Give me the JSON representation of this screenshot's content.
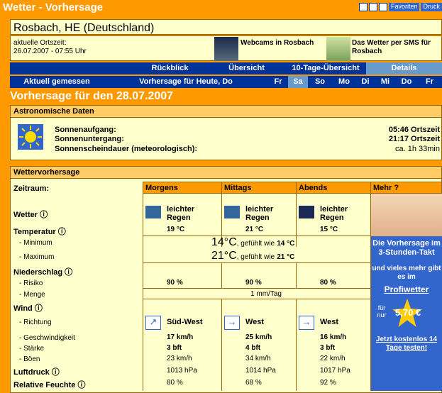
{
  "header": {
    "title": "Wetter - Vorhersage",
    "links": [
      "Favoriten",
      "Druck"
    ]
  },
  "location": {
    "city": "Rosbach, HE (Deutschland)",
    "localtime_label": "aktuelle Ortszeit:",
    "localtime_value": "26.07.2007 - 07:55 Uhr",
    "webcam_text": "Webcams in Rosbach",
    "sms_text": "Das Wetter per SMS für Rosbach"
  },
  "nav": {
    "tabs": [
      "Rückblick",
      "Übersicht",
      "10-Tage-Übersicht",
      "Details"
    ],
    "tab_selected": "Details",
    "current": "Aktuell gemessen",
    "forecast_label": "Vorhersage für Heute, Do",
    "days": [
      "Fr",
      "Sa",
      "So",
      "Mo",
      "Di",
      "Mi",
      "Do",
      "Fr"
    ],
    "day_selected": "Sa"
  },
  "heading": "Vorhersage für den 28.07.2007",
  "astro": {
    "title": "Astronomische Daten",
    "rows": [
      {
        "label": "Sonnenaufgang:",
        "value": "05:46 Ortszeit"
      },
      {
        "label": "Sonnenuntergang:",
        "value": "21:17 Ortszeit"
      },
      {
        "label": "Sonnenscheindauer (meteorologisch):",
        "value": "ca. 1h 33min"
      }
    ]
  },
  "forecast": {
    "title": "Wettervorhersage",
    "period_label": "Zeitraum:",
    "columns": [
      "Morgens",
      "Mittags",
      "Abends",
      "Mehr ?"
    ],
    "labels": {
      "wetter": "Wetter",
      "temperatur": "Temperatur",
      "minimum": "- Minimum",
      "maximum": "- Maximum",
      "niederschlag": "Niederschlag",
      "risiko": "- Risiko",
      "menge": "- Menge",
      "wind": "Wind",
      "richtung": "- Richtung",
      "geschwindigkeit": "- Geschwindigkeit",
      "staerke": "- Stärke",
      "boeen": "- Böen",
      "luftdruck": "Luftdruck",
      "feuchte": "Relative Feuchte"
    },
    "weather": [
      {
        "text": "leichter Regen",
        "temp": "19 °C"
      },
      {
        "text": "leichter Regen",
        "temp": "21 °C"
      },
      {
        "text": "leichter Regen",
        "temp": "15 °C"
      }
    ],
    "min_temp": "14°C",
    "min_felt": ", gefühlt wie",
    "min_felt_val": "14 °C",
    "max_temp": "21°C",
    "max_felt": ", gefühlt wie",
    "max_felt_val": "21 °C",
    "risk": [
      "90 %",
      "90 %",
      "80 %"
    ],
    "amount": "1 mm/Tag",
    "direction": [
      "Süd-West",
      "West",
      "West"
    ],
    "speed": [
      "17 km/h",
      "25 km/h",
      "16 km/h"
    ],
    "strength": [
      "3 bft",
      "4 bft",
      "3 bft"
    ],
    "gusts": [
      "23 km/h",
      "34 km/h",
      "22 km/h"
    ],
    "pressure": [
      "1013 hPa",
      "1014 hPa",
      "1017 hPa"
    ],
    "humidity": [
      "80 %",
      "68 %",
      "92 %"
    ]
  },
  "ad": {
    "line1": "Die Vorhersage im 3-Stunden-Takt",
    "line2": "und vieles mehr gibt es im",
    "link": "Profiwetter",
    "price_pre": "für nur",
    "price": "5,70 €",
    "cta": "Jetzt kostenlos 14 Tage testen!"
  }
}
